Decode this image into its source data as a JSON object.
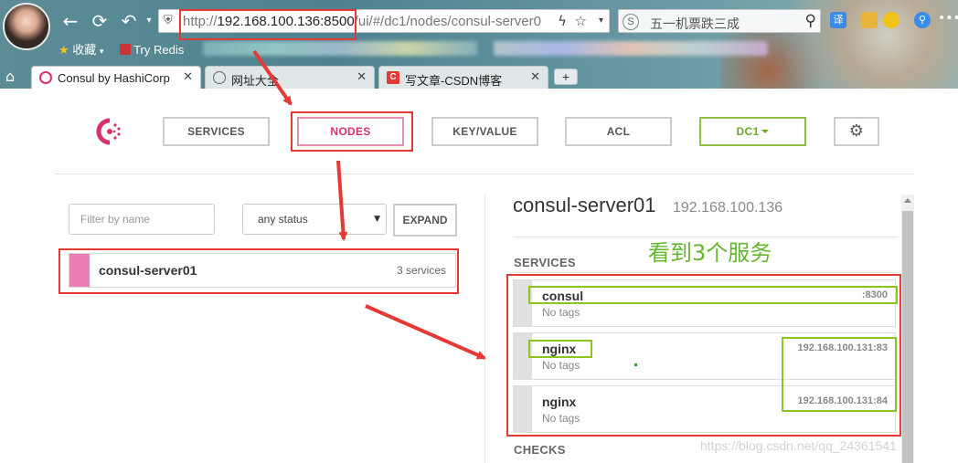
{
  "browser": {
    "url_scheme": "http://",
    "url_host": "192.168.100.136:8500",
    "url_path": "/ui/#/dc1/nodes/consul-server0",
    "search_placeholder": "五一机票跌三成",
    "search_logo": "S",
    "bookmarks": [
      {
        "label": "收藏"
      },
      {
        "label": "Try Redis"
      }
    ],
    "tabs": [
      {
        "label": "Consul by HashiCorp",
        "active": true
      },
      {
        "label": "网址大全",
        "active": false
      },
      {
        "label": "写文章-CSDN博客",
        "active": false
      }
    ],
    "ext_translate": "译"
  },
  "consul": {
    "nav": {
      "services": "SERVICES",
      "nodes": "NODES",
      "keyvalue": "KEY/VALUE",
      "acl": "ACL",
      "datacenter": "DC1"
    },
    "filter": {
      "placeholder": "Filter by name",
      "status": "any status",
      "expand": "EXPAND"
    },
    "nodes": [
      {
        "name": "consul-server01",
        "services": "3 services"
      }
    ],
    "detail": {
      "name": "consul-server01",
      "ip": "192.168.100.136",
      "services_label": "SERVICES",
      "checks_label": "CHECKS",
      "services": [
        {
          "name": "consul",
          "tags": "No tags",
          "address": ":8300"
        },
        {
          "name": "nginx",
          "tags": "No tags",
          "address": "192.168.100.131:83"
        },
        {
          "name": "nginx",
          "tags": "No tags",
          "address": "192.168.100.131:84"
        }
      ]
    }
  },
  "annotation": {
    "text": "看到3个服务",
    "color_red": "#e53935",
    "color_green": "#8cc51e"
  },
  "watermark": "https://blog.csdn.net/qq_24361541",
  "colors": {
    "nodes_accent": "#d6336c",
    "dc_accent": "#6eaa2a",
    "node_bar": "#e97fb4"
  }
}
